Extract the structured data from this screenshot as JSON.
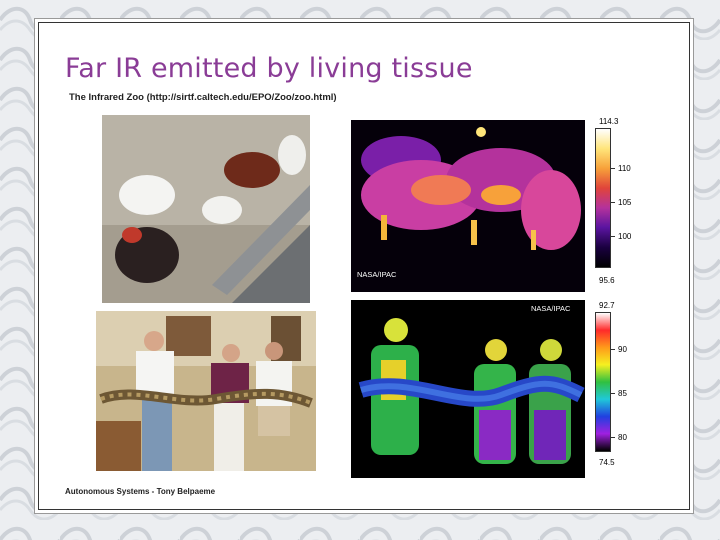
{
  "slide": {
    "title": "Far IR emitted by living tissue",
    "subtitle": "The Infrared Zoo (http://sirtf.caltech.edu/EPO/Zoo/zoo.html)",
    "footer": "Autonomous Systems - Tony Belpaeme"
  },
  "thermal_chickens": {
    "credit": "NASA/IPAC",
    "scale_labels": [
      "114.3",
      "110",
      "105",
      "100",
      "95.6"
    ]
  },
  "thermal_people": {
    "credit": "NASA/IPAC",
    "scale_labels": [
      "92.7",
      "90",
      "85",
      "80",
      "74.5"
    ]
  },
  "colors": {
    "title": "#8a3c96",
    "border": "#333333"
  }
}
